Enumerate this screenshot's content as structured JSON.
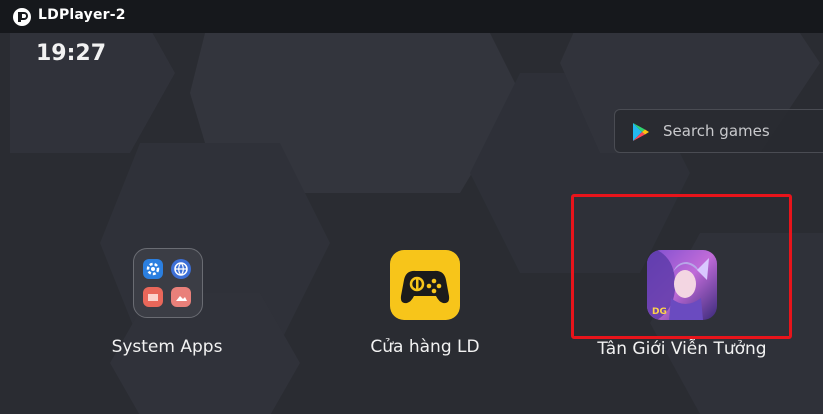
{
  "window": {
    "title": "LDPlayer-2",
    "icon": "ldplayer-logo-icon"
  },
  "status": {
    "time": "19:27"
  },
  "search": {
    "placeholder": "Search games",
    "icon": "google-play-icon"
  },
  "apps": [
    {
      "label": "System Apps",
      "icon": "folder-icon"
    },
    {
      "label": "Cửa hàng LD",
      "icon": "gamepad-icon"
    },
    {
      "label": "Tân Giới Viễn Tưởng",
      "icon": "game-portrait-icon"
    }
  ],
  "colors": {
    "background": "#2a2c32",
    "titlebar": "#16181c",
    "store_yellow": "#f7c51a",
    "highlight_border": "#e8141b"
  }
}
